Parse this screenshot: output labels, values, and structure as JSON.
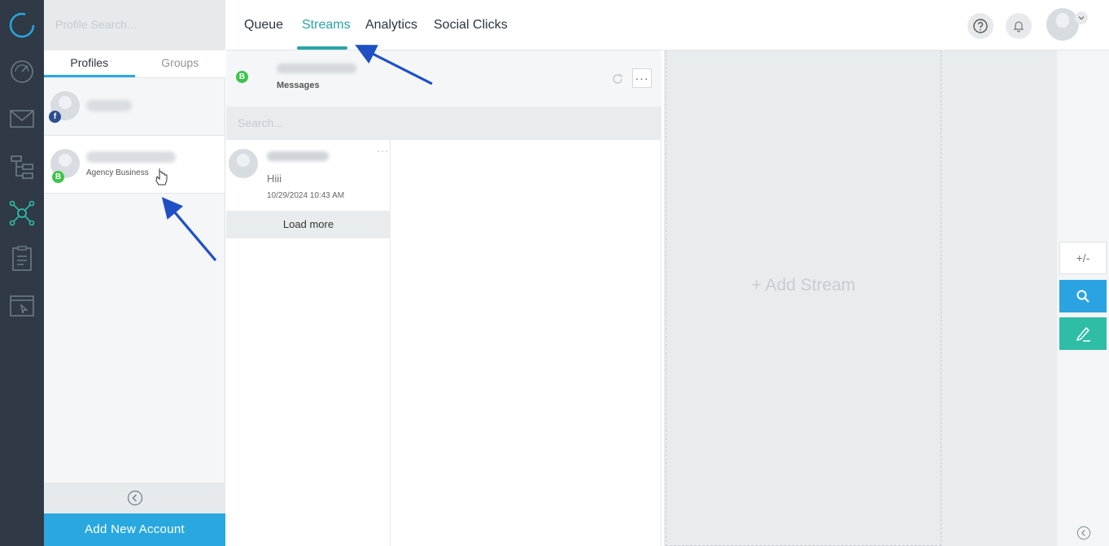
{
  "colors": {
    "rail": "#2f3a46",
    "accent_blue": "#29a8e0",
    "accent_teal": "#29a3a6",
    "compose_green": "#2fbda7",
    "arrow": "#1f4fc4"
  },
  "rail": {
    "items": [
      {
        "name": "logo-ring-icon"
      },
      {
        "name": "dashboard-gauge-icon"
      },
      {
        "name": "inbox-mail-icon"
      },
      {
        "name": "publishing-tree-icon"
      },
      {
        "name": "streams-network-icon"
      },
      {
        "name": "reports-clipboard-icon"
      },
      {
        "name": "browser-window-icon"
      }
    ]
  },
  "profiles_panel": {
    "search_placeholder": "Profile Search...",
    "tabs": [
      {
        "label": "Profiles",
        "active": true
      },
      {
        "label": "Groups",
        "active": false
      }
    ],
    "profiles": [
      {
        "network": "facebook",
        "badge": "f",
        "subtitle": ""
      },
      {
        "network": "whatsapp-business",
        "badge": "B",
        "subtitle": "Agency Business"
      }
    ],
    "add_account_label": "Add New Account"
  },
  "topnav": {
    "tabs": [
      {
        "label": "Queue",
        "active": false
      },
      {
        "label": "Streams",
        "active": true
      },
      {
        "label": "Analytics",
        "active": false
      },
      {
        "label": "Social Clicks",
        "active": false
      }
    ],
    "help_icon": "help-circle-icon",
    "notifications_icon": "bell-icon"
  },
  "stream": {
    "badge": "B",
    "type_label": "Messages",
    "menu_label": "···",
    "search_placeholder": "Search...",
    "messages": [
      {
        "text": "Hiii",
        "timestamp": "10/29/2024 10:43 AM"
      }
    ],
    "load_more_label": "Load more"
  },
  "add_stream": {
    "label": "+ Add Stream"
  },
  "right_tools": {
    "resize_label": "+/-",
    "search_icon": "search-icon",
    "compose_icon": "compose-pen-icon"
  }
}
